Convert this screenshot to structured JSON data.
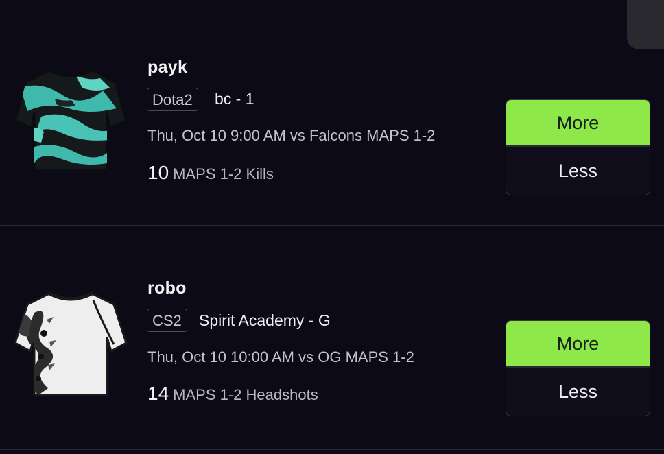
{
  "accent_color": "#8fe84a",
  "background_color": "#0b0a16",
  "cards": [
    {
      "player": "payk",
      "game": "Dota2",
      "team": "bc - 1",
      "match": "Thu, Oct 10 9:00 AM vs Falcons MAPS 1-2",
      "line_value": "10",
      "line_stat": "MAPS 1-2 Kills",
      "more_label": "More",
      "less_label": "Less",
      "jersey_icon": "teal-camo-jersey-icon"
    },
    {
      "player": "robo",
      "game": "CS2",
      "team": "Spirit Academy - G",
      "match": "Thu, Oct 10 10:00 AM vs OG MAPS 1-2",
      "line_value": "14",
      "line_stat": "MAPS 1-2 Headshots",
      "more_label": "More",
      "less_label": "Less",
      "jersey_icon": "white-dragon-jersey-icon"
    }
  ]
}
